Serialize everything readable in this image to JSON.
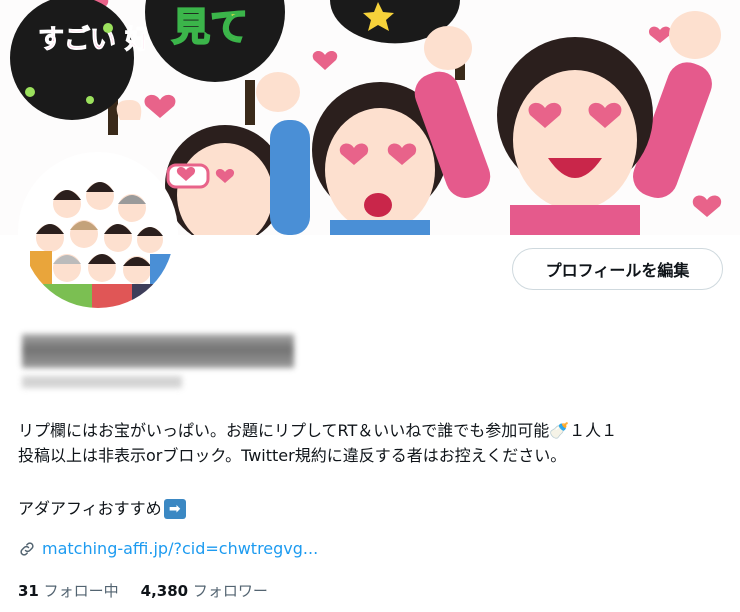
{
  "profile": {
    "edit_button": "プロフィールを編集",
    "bio": "リプ欄にはお宝がいっぱい。お題にリプしてRT＆いいねで誰でも参加可能🍼１人１\n投稿以上は非表示orブロック。Twitter規約に違反する者はお控えください。",
    "recommend": "アダアフィおすすめ",
    "link": "matching-affi.jp/?cid=chwtregvg...",
    "following_count": "31",
    "following_label": "フォロー中",
    "followers_count": "4,380",
    "followers_label": "フォロワー"
  },
  "banner": {
    "sign_left": "すごい 好き",
    "sign_center": "見て"
  }
}
